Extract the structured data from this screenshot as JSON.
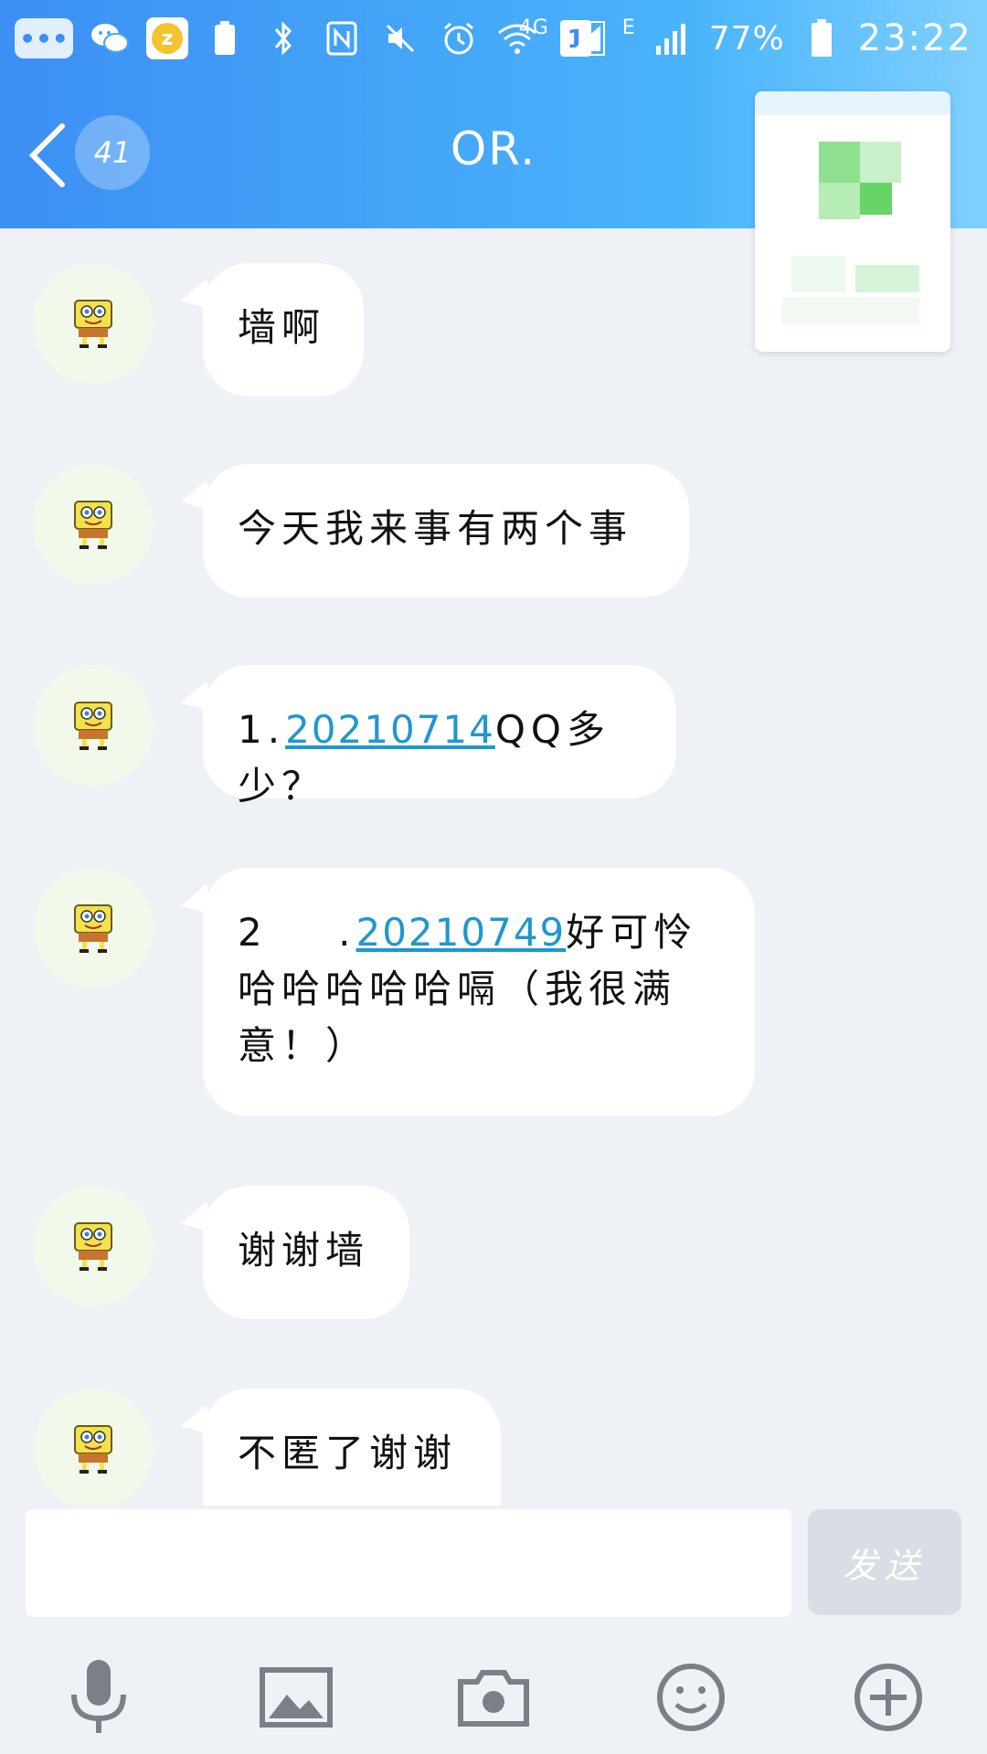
{
  "status_bar": {
    "notification_count": "1",
    "network_4g": "4G",
    "network_e": "E",
    "battery": "77%",
    "time": "23:22",
    "icons": [
      "more-icon",
      "wechat-icon",
      "qzone-icon",
      "storage-icon",
      "bluetooth-icon",
      "nfc-icon",
      "mute-icon",
      "alarm-icon",
      "wifi-icon",
      "notification-count-icon",
      "signal-icon",
      "signal-2-icon",
      "battery-icon"
    ]
  },
  "header": {
    "back_icon": "back-chevron-icon",
    "unread_count": "41",
    "title": "OR."
  },
  "messages": [
    {
      "parts": [
        {
          "text": "墙啊"
        }
      ]
    },
    {
      "parts": [
        {
          "text": "今天我来事有两个事"
        }
      ]
    },
    {
      "parts": [
        {
          "text": "1."
        },
        {
          "text": "20210714",
          "link": true
        },
        {
          "text": "QQ多少？"
        }
      ]
    },
    {
      "parts": [
        {
          "text": "2    ."
        },
        {
          "text": "20210749",
          "link": true
        },
        {
          "text": "好可怜哈哈哈哈哈嗝（我很满意！）"
        }
      ]
    },
    {
      "parts": [
        {
          "text": "谢谢墙"
        }
      ]
    },
    {
      "parts": [
        {
          "text": "不匿了谢谢"
        }
      ]
    }
  ],
  "input": {
    "value": "",
    "send_label": "发送"
  },
  "toolbar": {
    "icons": [
      "microphone-icon",
      "image-icon",
      "camera-icon",
      "emoji-icon",
      "plus-icon"
    ]
  },
  "colors": {
    "header_start": "#3c8ff3",
    "header_end": "#7fd0ff",
    "background": "#eef1f6",
    "link": "#1f97cf",
    "send_disabled": "#d9dde4"
  }
}
